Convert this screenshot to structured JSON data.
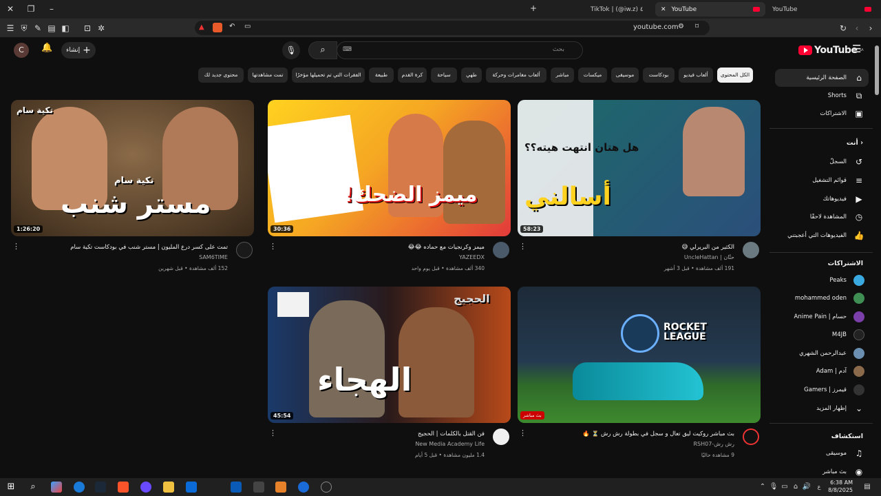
{
  "browser": {
    "tabs": [
      {
        "label": "TikTok | (@iw.z) ٤"
      },
      {
        "label": "YouTube"
      },
      {
        "label": "YouTube"
      }
    ],
    "url": "youtube.com"
  },
  "header": {
    "logo_text": "YouTube",
    "logo_region": "SA",
    "search_placeholder": "بحث",
    "create_label": "إنشاء",
    "avatar_letter": "C"
  },
  "chips": [
    "الكل المحتوى",
    "ألعاب فيديو",
    "بودكاست",
    "موسيقى",
    "ميكسات",
    "مباشر",
    "ألعاب مغامرات وحركة",
    "طهي",
    "سياحة",
    "كرة القدم",
    "طبيعة",
    "الفقرات التي تم تحميلها مؤخرًا",
    "تمت مشاهدتها",
    "محتوى جديد لك"
  ],
  "sidebar": {
    "main": [
      {
        "label": "الصفحة الرئيسية",
        "icon": "home-icon"
      },
      {
        "label": "Shorts",
        "icon": "shorts-icon"
      },
      {
        "label": "الاشتراكات",
        "icon": "subscriptions-icon"
      }
    ],
    "you_header": "أنت",
    "you": [
      {
        "label": "السجلّ",
        "icon": "history-icon"
      },
      {
        "label": "قوائم التشغيل",
        "icon": "playlist-icon"
      },
      {
        "label": "فيديوهاتك",
        "icon": "your-videos-icon"
      },
      {
        "label": "المشاهدة لاحقًا",
        "icon": "watch-later-icon"
      },
      {
        "label": "الفيديوهات التي أعجبتني",
        "icon": "like-icon"
      }
    ],
    "subs_header": "الاشتراكات",
    "subs": [
      {
        "label": "Peaks",
        "color": "#3aa9e0"
      },
      {
        "label": "mohammed oden",
        "color": "#3f8f55"
      },
      {
        "label": "Anime Pain | حسام",
        "color": "#7a3fa8"
      },
      {
        "label": "M4JB",
        "color": "#222222"
      },
      {
        "label": "عبدالرحمن الشهري",
        "color": "#6a8fb0"
      },
      {
        "label": "Adam | آدم",
        "color": "#8a6a4a"
      },
      {
        "label": "Gamers | قيمرز",
        "color": "#333333"
      }
    ],
    "show_more": "إظهار المزيد",
    "explore_header": "استكشاف",
    "explore": [
      {
        "label": "موسيقى",
        "icon": "music-icon"
      },
      {
        "label": "بث مباشر",
        "icon": "live-icon"
      }
    ]
  },
  "videos": [
    {
      "title": "الكثير من البريرلي 😅",
      "channel": "UncleHattan | حتّان",
      "meta": "191 ألف مشاهدة • قبل 3 أشهر",
      "duration": "58:23",
      "thumb_text": "أسالني",
      "thumb_sub": "هل هتان انتهت هيته؟؟",
      "thumb_colors": [
        "#1c6b6a",
        "#2b4f7a"
      ]
    },
    {
      "title": "ميمز وكرنجيات مع حماده 😂😂",
      "channel": "YAZEEDX",
      "meta": "340 ألف مشاهدة • قبل يوم واحد",
      "duration": "30:36",
      "thumb_text": "ميمز الضحك!",
      "thumb_sub": "",
      "thumb_colors": [
        "#ffd21f",
        "#e23a3a"
      ]
    },
    {
      "title": "تمت على كسر درع المليون | مستر شنب في بودكاست تكية سام",
      "channel": "SAM6TIME",
      "meta": "152 ألف مشاهدة • قبل شهرين",
      "duration": "1:26:20",
      "thumb_text": "مستر شنب",
      "thumb_sub": "تكية سام",
      "thumb_colors": [
        "#6a4a2a",
        "#3a2a1a"
      ]
    },
    {
      "title": "بث مباشر روكيت ليق تعال و سجل في بطولة رش رش ⏳ 🔥",
      "channel": "RSH07-رش رش",
      "meta": "9 مشاهدة حاليًا",
      "duration": "",
      "live_label": "بث مباشر",
      "thumb_text": "ROCKET LEAGUE",
      "thumb_sub": "",
      "thumb_colors": [
        "#1d2a38",
        "#2f6a2a"
      ]
    },
    {
      "title": "فن القتل بالكلمات | الحجيج",
      "channel": "New Media Academy Life",
      "meta": "1.4 مليون مشاهدة • قبل 5 أيام",
      "duration": "45:54",
      "thumb_text": "الهجاء",
      "thumb_sub": "الحجيج",
      "thumb_colors": [
        "#1a3a6a",
        "#b84a1a"
      ]
    }
  ],
  "taskbar": {
    "time": "6:38 AM",
    "date": "8/8/2025",
    "lang": "ع"
  }
}
